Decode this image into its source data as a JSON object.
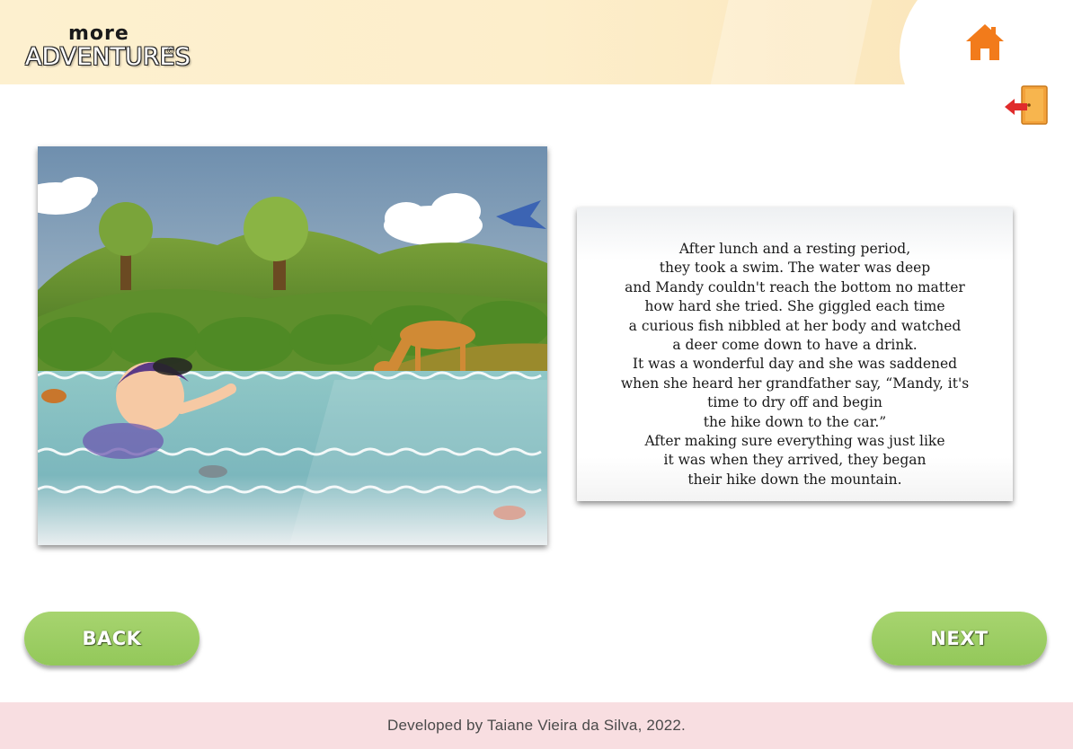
{
  "brand": {
    "logo_small": "more",
    "logo_big": "ADVENTURES",
    "logo_mark": "©",
    "colors": {
      "header_bg": "#fdeecb",
      "button_green": "#9acd5f",
      "footer_bg": "#f8dee1",
      "icon_orange": "#f27b1b"
    }
  },
  "header": {
    "home_icon": "home-icon",
    "exit_icon": "exit-door-icon"
  },
  "page": {
    "illustration": "girl-swimming-deer-drinking-scene",
    "story_lines": [
      "After lunch and a resting period,",
      "they took a swim. The water was deep",
      "and Mandy couldn't reach the bottom no matter",
      "how hard she tried. She giggled each time",
      "a curious fish nibbled at her body and watched",
      "a deer come down to have a drink.",
      "It was a wonderful day and she was saddened",
      "when she heard her grandfather say, “Mandy, it's",
      "time to dry off and begin",
      "the hike down to the car.”",
      "After making sure everything was just like",
      "it was when they arrived, they began",
      "their hike down the mountain."
    ]
  },
  "nav": {
    "back_label": "BACK",
    "next_label": "NEXT"
  },
  "footer": {
    "credit": "Developed by Taiane Vieira da Silva, 2022."
  }
}
